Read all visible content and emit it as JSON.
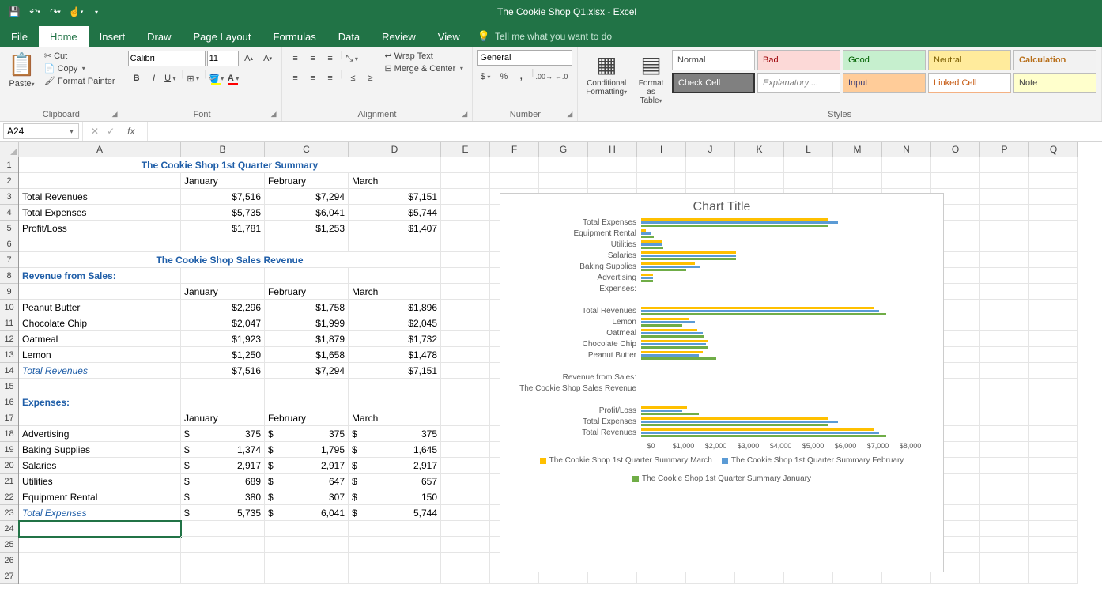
{
  "app": {
    "title": "The Cookie Shop Q1.xlsx  -  Excel"
  },
  "qat": {
    "save": "💾",
    "undo": "↶",
    "redo": "↷",
    "touch": "👆"
  },
  "tabs": {
    "file": "File",
    "home": "Home",
    "insert": "Insert",
    "draw": "Draw",
    "pagelayout": "Page Layout",
    "formulas": "Formulas",
    "data": "Data",
    "review": "Review",
    "view": "View",
    "tellme": "Tell me what you want to do"
  },
  "ribbon": {
    "clipboard": {
      "label": "Clipboard",
      "paste": "Paste",
      "cut": "Cut",
      "copy": "Copy",
      "fp": "Format Painter"
    },
    "font": {
      "label": "Font",
      "name": "Calibri",
      "size": "11"
    },
    "alignment": {
      "label": "Alignment",
      "wrap": "Wrap Text",
      "merge": "Merge & Center"
    },
    "number": {
      "label": "Number",
      "format": "General"
    },
    "styles": {
      "label": "Styles",
      "cond": "Conditional Formatting",
      "table": "Format as Table",
      "normal": "Normal",
      "bad": "Bad",
      "good": "Good",
      "neutral": "Neutral",
      "calc": "Calculation",
      "check": "Check Cell",
      "expl": "Explanatory ...",
      "input": "Input",
      "linked": "Linked Cell",
      "note": "Note"
    }
  },
  "namebox": "A24",
  "cols": [
    "A",
    "B",
    "C",
    "D",
    "E",
    "F",
    "G",
    "H",
    "I",
    "J",
    "K",
    "L",
    "M",
    "N",
    "O",
    "P",
    "Q"
  ],
  "rows": [
    "1",
    "2",
    "3",
    "4",
    "5",
    "6",
    "7",
    "8",
    "9",
    "10",
    "11",
    "12",
    "13",
    "14",
    "15",
    "16",
    "17",
    "18",
    "19",
    "20",
    "21",
    "22",
    "23",
    "24",
    "25",
    "26",
    "27"
  ],
  "sheet": {
    "title1": "The Cookie Shop 1st Quarter Summary",
    "months": [
      "January",
      "February",
      "March"
    ],
    "sum_rows": [
      {
        "label": "Total Revenues",
        "vals": [
          "$7,516",
          "$7,294",
          "$7,151"
        ]
      },
      {
        "label": "Total Expenses",
        "vals": [
          "$5,735",
          "$6,041",
          "$5,744"
        ]
      },
      {
        "label": "Profit/Loss",
        "vals": [
          "$1,781",
          "$1,253",
          "$1,407"
        ]
      }
    ],
    "title2": "The Cookie Shop Sales Revenue",
    "rev_header": "Revenue from Sales:",
    "rev_rows": [
      {
        "label": "Peanut Butter",
        "vals": [
          "$2,296",
          "$1,758",
          "$1,896"
        ]
      },
      {
        "label": "Chocolate Chip",
        "vals": [
          "$2,047",
          "$1,999",
          "$2,045"
        ]
      },
      {
        "label": "Oatmeal",
        "vals": [
          "$1,923",
          "$1,879",
          "$1,732"
        ]
      },
      {
        "label": "Lemon",
        "vals": [
          "$1,250",
          "$1,658",
          "$1,478"
        ]
      }
    ],
    "rev_total": {
      "label": "Total Revenues",
      "vals": [
        "$7,516",
        "$7,294",
        "$7,151"
      ]
    },
    "exp_header": "Expenses:",
    "exp_rows": [
      {
        "label": "Advertising",
        "vals": [
          "375",
          "375",
          "375"
        ]
      },
      {
        "label": "Baking Supplies",
        "vals": [
          "1,374",
          "1,795",
          "1,645"
        ]
      },
      {
        "label": "Salaries",
        "vals": [
          "2,917",
          "2,917",
          "2,917"
        ]
      },
      {
        "label": "Utilities",
        "vals": [
          "689",
          "647",
          "657"
        ]
      },
      {
        "label": "Equipment Rental",
        "vals": [
          "380",
          "307",
          "150"
        ]
      }
    ],
    "exp_total": {
      "label": "Total Expenses",
      "vals": [
        "5,735",
        "6,041",
        "5,744"
      ]
    },
    "dollar": "$"
  },
  "chart": {
    "title": "Chart Title",
    "legend": {
      "march": "The Cookie Shop 1st Quarter Summary March",
      "feb": "The Cookie Shop 1st Quarter Summary February",
      "jan": "The Cookie Shop 1st Quarter Summary January"
    },
    "axis": [
      "$0",
      "$1,000",
      "$2,000",
      "$3,000",
      "$4,000",
      "$5,000",
      "$6,000",
      "$7,000",
      "$8,000"
    ]
  },
  "chart_data": {
    "type": "bar",
    "title": "Chart Title",
    "xlabel": "",
    "ylabel": "",
    "xlim": [
      0,
      8000
    ],
    "categories": [
      "Total Expenses",
      "Equipment Rental",
      "Utilities",
      "Salaries",
      "Baking Supplies",
      "Advertising",
      "Expenses:",
      "",
      "Total Revenues",
      "Lemon",
      "Oatmeal",
      "Chocolate Chip",
      "Peanut Butter",
      "",
      "Revenue from Sales:",
      "The Cookie Shop Sales Revenue",
      "",
      "Profit/Loss",
      "Total Expenses",
      "Total Revenues"
    ],
    "series": [
      {
        "name": "The Cookie Shop 1st Quarter Summary March",
        "values": [
          5744,
          150,
          657,
          2917,
          1645,
          375,
          null,
          null,
          7151,
          1478,
          1732,
          2045,
          1896,
          null,
          null,
          null,
          null,
          1407,
          5744,
          7151
        ]
      },
      {
        "name": "The Cookie Shop 1st Quarter Summary February",
        "values": [
          6041,
          307,
          647,
          2917,
          1795,
          375,
          null,
          null,
          7294,
          1658,
          1879,
          1999,
          1758,
          null,
          null,
          null,
          null,
          1253,
          6041,
          7294
        ]
      },
      {
        "name": "The Cookie Shop 1st Quarter Summary January",
        "values": [
          5735,
          380,
          689,
          2917,
          1374,
          375,
          null,
          null,
          7516,
          1250,
          1923,
          2047,
          2296,
          null,
          null,
          null,
          null,
          1781,
          5735,
          7516
        ]
      }
    ]
  }
}
